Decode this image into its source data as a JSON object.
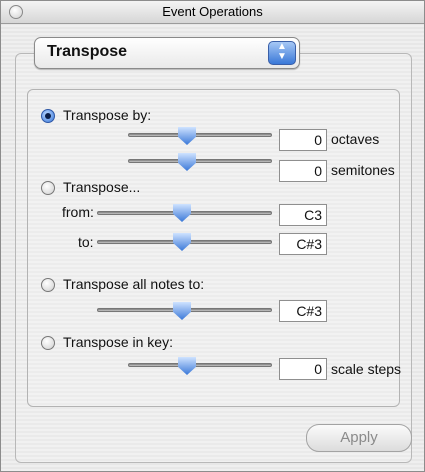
{
  "window": {
    "title": "Event Operations"
  },
  "operation_popup": {
    "selected": "Transpose"
  },
  "transpose_by": {
    "label": "Transpose by:",
    "selected": true,
    "octaves": {
      "value": "0",
      "unit": "octaves"
    },
    "semitones": {
      "value": "0",
      "unit": "semitones"
    }
  },
  "transpose_from_to": {
    "label": "Transpose...",
    "from_label": "from:",
    "from_value": "C3",
    "to_label": "to:",
    "to_value": "C#3"
  },
  "transpose_all": {
    "label": "Transpose all notes to:",
    "value": "C#3"
  },
  "transpose_in_key": {
    "label": "Transpose in key:",
    "value": "0",
    "unit": "scale steps"
  },
  "apply_button": {
    "label": "Apply",
    "enabled": false
  }
}
